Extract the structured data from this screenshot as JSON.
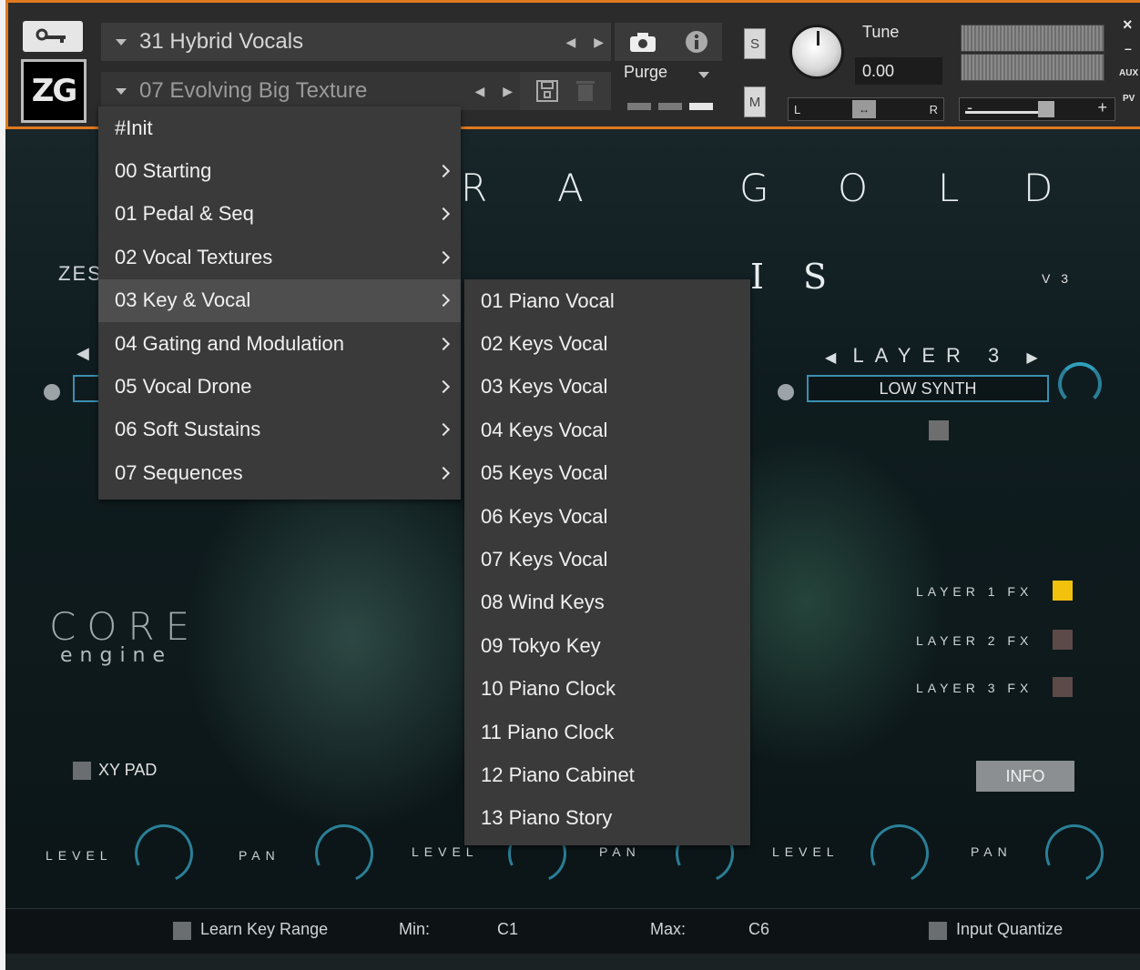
{
  "header": {
    "instrument_name": "31 Hybrid Vocals",
    "preset_name": "07 Evolving Big Texture",
    "logo_text": "ZG",
    "purge_label": "Purge",
    "solo_label": "S",
    "mute_label": "M",
    "tune_label": "Tune",
    "tune_value": "0.00",
    "pan_left": "L",
    "pan_right": "R",
    "volume_minus": "-",
    "volume_plus": "+",
    "close": "×",
    "minimize": "–",
    "aux": "AUX",
    "pv": "PV"
  },
  "main": {
    "title_letters": [
      "R",
      "A",
      "G",
      "O",
      "L",
      "D"
    ],
    "subtitle_letters": [
      "I",
      "S"
    ],
    "version": "V 3",
    "brand_fragment": "ZES",
    "layer_selector": "LAYER 3",
    "layer_patch": "LOW SYNTH",
    "core": "CORE",
    "engine": "engine",
    "fx": [
      "LAYER 1 FX",
      "LAYER 2 FX",
      "LAYER 3 FX"
    ],
    "info_button": "INFO",
    "xy_pad": "XY PAD",
    "knobs": [
      "LEVEL",
      "PAN",
      "LEVEL",
      "PAN",
      "LEVEL",
      "PAN"
    ],
    "learn_key_range": "Learn Key Range",
    "min_label": "Min:",
    "min_value": "C1",
    "max_label": "Max:",
    "max_value": "C6",
    "input_quantize": "Input Quantize"
  },
  "menu_categories": [
    {
      "label": "#Init",
      "submenu": false
    },
    {
      "label": "00 Starting",
      "submenu": true
    },
    {
      "label": "01 Pedal & Seq",
      "submenu": true
    },
    {
      "label": "02 Vocal Textures",
      "submenu": true
    },
    {
      "label": "03 Key & Vocal",
      "submenu": true,
      "highlighted": true
    },
    {
      "label": "04 Gating and Modulation",
      "submenu": true
    },
    {
      "label": "05 Vocal Drone",
      "submenu": true
    },
    {
      "label": "06 Soft Sustains",
      "submenu": true
    },
    {
      "label": "07 Sequences",
      "submenu": true
    }
  ],
  "submenu_items": [
    "01 Piano Vocal",
    "02 Keys Vocal",
    "03 Keys Vocal",
    "04 Keys Vocal",
    "05 Keys Vocal",
    "06 Keys Vocal",
    "07 Keys Vocal",
    "08 Wind Keys",
    "09 Tokyo Key",
    "10 Piano Clock",
    "11 Piano Clock",
    "12 Piano Cabinet",
    "13 Piano Story"
  ],
  "colors": {
    "header_border": "#e07a1f",
    "accent_teal": "#2a7f96",
    "fx_on": "#f2c10d",
    "menu_bg": "#3a3a3a",
    "menu_highlight": "#4e4e4e"
  }
}
